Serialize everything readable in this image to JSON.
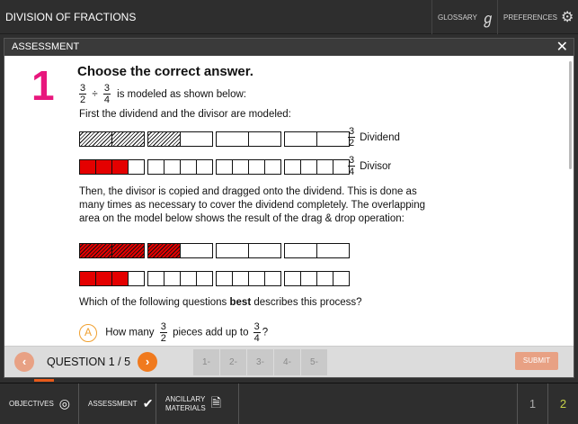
{
  "app": {
    "title": "DIVISION OF FRACTIONS"
  },
  "topbar": {
    "glossary": "GLOSSARY",
    "preferences": "PREFERENCES",
    "glossary_icon": "g-icon",
    "preferences_icon": "gear-icon"
  },
  "panel": {
    "title": "ASSESSMENT",
    "close": "✕"
  },
  "question": {
    "number": "1",
    "title": "Choose the correct answer.",
    "expr_a_num": "3",
    "expr_a_den": "2",
    "op": "÷",
    "expr_b_num": "3",
    "expr_b_den": "4",
    "expr_suffix": "is modeled as shown below:",
    "line2": "First the dividend and the divisor are modeled:",
    "dividend_num": "3",
    "dividend_den": "2",
    "dividend_label": "Dividend",
    "divisor_num": "3",
    "divisor_den": "4",
    "divisor_label": "Divisor",
    "paragraph": "Then, the divisor is copied and dragged onto the dividend. This is done as many times as necessary to cover the dividend completely. The overlapping area on the model below shows the result of the drag & drop operation:",
    "prompt_pre": "Which of the following questions",
    "prompt_bold": "best",
    "prompt_post": "describes this process?",
    "option_a": {
      "letter": "A",
      "pre": "How many",
      "num": "3",
      "den": "2",
      "mid": "pieces add up to",
      "num2": "3",
      "den2": "4",
      "post": "?"
    }
  },
  "nav": {
    "prev": "‹",
    "next": "›",
    "label": "QUESTION 1 / 5",
    "pages": [
      "1-",
      "2-",
      "3-",
      "4-",
      "5-"
    ],
    "submit": "SUBMIT"
  },
  "bottom": {
    "objectives": "OBJECTIVES",
    "assessment": "ASSESSMENT",
    "ancillary_1": "ANCILLARY",
    "ancillary_2": "MATERIALS",
    "page1": "1",
    "page2": "2"
  },
  "colors": {
    "accent": "#e8177d",
    "orange": "#f07a1e",
    "red": "#e40000"
  }
}
